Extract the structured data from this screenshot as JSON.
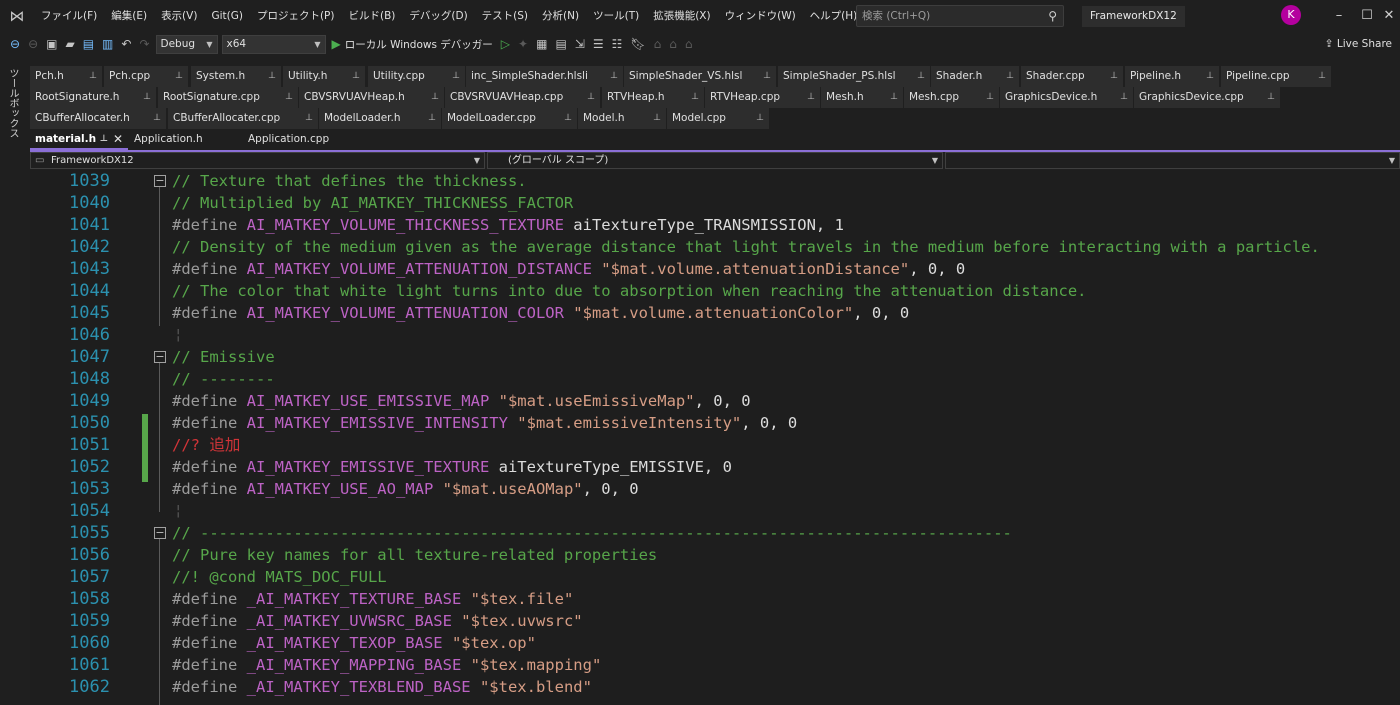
{
  "menu": {
    "items": [
      "ファイル(F)",
      "編集(E)",
      "表示(V)",
      "Git(G)",
      "プロジェクト(P)",
      "ビルド(B)",
      "デバッグ(D)",
      "テスト(S)",
      "分析(N)",
      "ツール(T)",
      "拡張機能(X)",
      "ウィンドウ(W)",
      "ヘルプ(H)"
    ],
    "search_placeholder": "検索 (Ctrl+Q)",
    "solution_name": "FrameworkDX12",
    "avatar_letter": "K"
  },
  "toolbar": {
    "config": "Debug",
    "platform": "x64",
    "run_label": "ローカル Windows デバッガー",
    "live_share": "Live Share"
  },
  "toolbox": {
    "label": "ツールボックス"
  },
  "tabs": {
    "row1": [
      "Pch.h",
      "Pch.cpp",
      "System.h",
      "Utility.h",
      "Utility.cpp",
      "inc_SimpleShader.hlsli",
      "SimpleShader_VS.hlsl",
      "SimpleShader_PS.hlsl",
      "Shader.h",
      "Shader.cpp",
      "Pipeline.h",
      "Pipeline.cpp"
    ],
    "row2": [
      "RootSignature.h",
      "RootSignature.cpp",
      "CBVSRVUAVHeap.h",
      "CBVSRVUAVHeap.cpp",
      "RTVHeap.h",
      "RTVHeap.cpp",
      "Mesh.h",
      "Mesh.cpp",
      "GraphicsDevice.h",
      "GraphicsDevice.cpp"
    ],
    "row3": [
      "CBufferAllocater.h",
      "CBufferAllocater.cpp",
      "ModelLoader.h",
      "ModelLoader.cpp",
      "Model.h",
      "Model.cpp"
    ],
    "row4_active": "material.h",
    "row4_others": [
      "Application.h",
      "Application.cpp"
    ]
  },
  "navbar": {
    "project": "FrameworkDX12",
    "scope": "(グローバル スコープ)"
  },
  "editor": {
    "lines": [
      {
        "n": "1039",
        "code": "// Texture that defines the thickness."
      },
      {
        "n": "1040",
        "code": "// Multiplied by AI_MATKEY_THICKNESS_FACTOR"
      },
      {
        "n": "1041",
        "code": "#define AI_MATKEY_VOLUME_THICKNESS_TEXTURE aiTextureType_TRANSMISSION, 1"
      },
      {
        "n": "1042",
        "code": "// Density of the medium given as the average distance that light travels in the medium before interacting with a particle."
      },
      {
        "n": "1043",
        "code": "#define AI_MATKEY_VOLUME_ATTENUATION_DISTANCE \"$mat.volume.attenuationDistance\", 0, 0"
      },
      {
        "n": "1044",
        "code": "// The color that white light turns into due to absorption when reaching the attenuation distance."
      },
      {
        "n": "1045",
        "code": "#define AI_MATKEY_VOLUME_ATTENUATION_COLOR \"$mat.volume.attenuationColor\", 0, 0"
      },
      {
        "n": "1046",
        "code": ""
      },
      {
        "n": "1047",
        "code": "// Emissive"
      },
      {
        "n": "1048",
        "code": "// --------"
      },
      {
        "n": "1049",
        "code": "#define AI_MATKEY_USE_EMISSIVE_MAP \"$mat.useEmissiveMap\", 0, 0"
      },
      {
        "n": "1050",
        "code": "#define AI_MATKEY_EMISSIVE_INTENSITY \"$mat.emissiveIntensity\", 0, 0"
      },
      {
        "n": "1051",
        "code": "//? 追加"
      },
      {
        "n": "1052",
        "code": "#define AI_MATKEY_EMISSIVE_TEXTURE aiTextureType_EMISSIVE, 0"
      },
      {
        "n": "1053",
        "code": "#define AI_MATKEY_USE_AO_MAP \"$mat.useAOMap\", 0, 0"
      },
      {
        "n": "1054",
        "code": ""
      },
      {
        "n": "1055",
        "code": "// ---------------------------------------------------------------------------------------"
      },
      {
        "n": "1056",
        "code": "// Pure key names for all texture-related properties"
      },
      {
        "n": "1057",
        "code": "//! @cond MATS_DOC_FULL"
      },
      {
        "n": "1058",
        "code": "#define _AI_MATKEY_TEXTURE_BASE \"$tex.file\""
      },
      {
        "n": "1059",
        "code": "#define _AI_MATKEY_UVWSRC_BASE \"$tex.uvwsrc\""
      },
      {
        "n": "1060",
        "code": "#define _AI_MATKEY_TEXOP_BASE \"$tex.op\""
      },
      {
        "n": "1061",
        "code": "#define _AI_MATKEY_MAPPING_BASE \"$tex.mapping\""
      },
      {
        "n": "1062",
        "code": "#define _AI_MATKEY_TEXBLEND_BASE \"$tex.blend\""
      }
    ]
  },
  "colors": {
    "accent": "#8b6fd6",
    "comment": "#57a64a",
    "macro": "#bd63c5",
    "string": "#d69d85",
    "line_number": "#2b91af"
  }
}
